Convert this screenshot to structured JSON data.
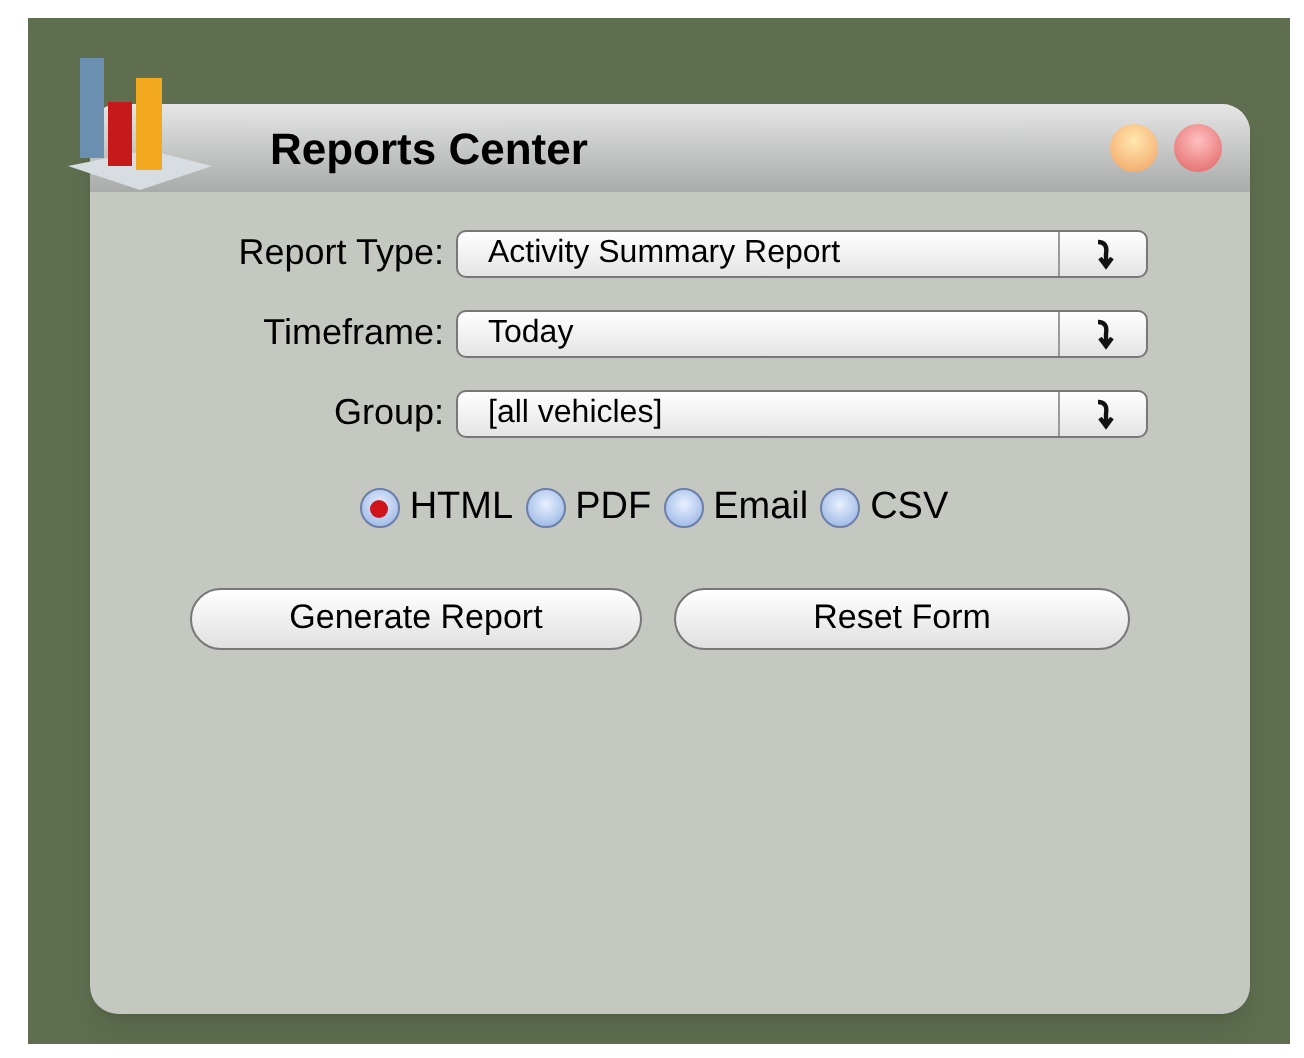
{
  "window": {
    "title": "Reports Center"
  },
  "fields": [
    {
      "label": "Report Type:",
      "value": "Activity Summary Report"
    },
    {
      "label": "Timeframe:",
      "value": "Today"
    },
    {
      "label": "Group:",
      "value": "[all vehicles]"
    }
  ],
  "formats": [
    {
      "label": "HTML",
      "selected": true
    },
    {
      "label": "PDF",
      "selected": false
    },
    {
      "label": "Email",
      "selected": false
    },
    {
      "label": "CSV",
      "selected": false
    }
  ],
  "buttons": [
    "Generate Report",
    "Reset Form"
  ]
}
